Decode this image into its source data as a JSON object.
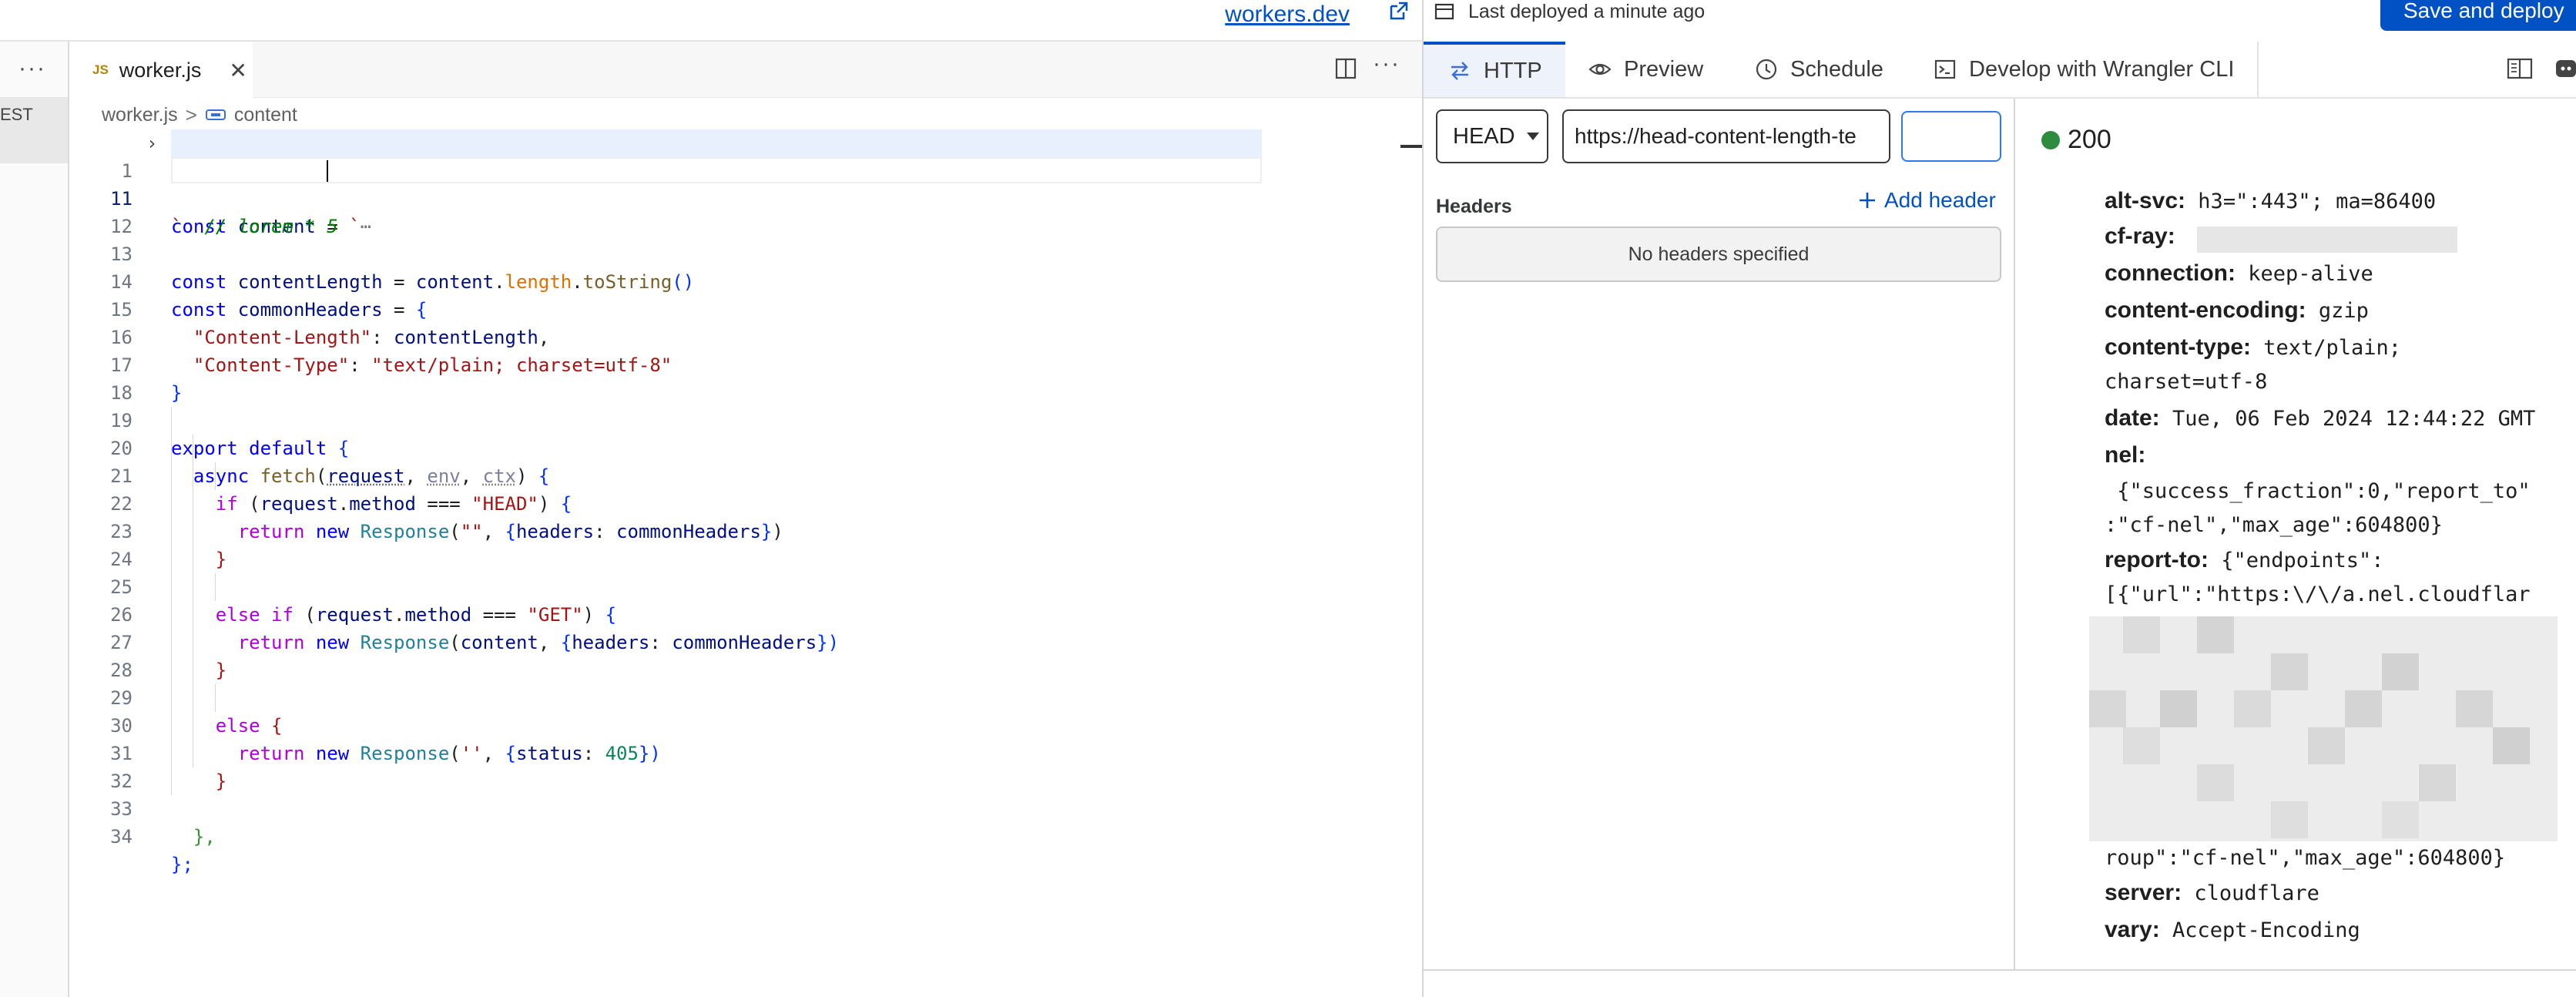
{
  "topbar": {
    "link_text": "workers.dev",
    "deploy_status": "Last deployed a minute ago",
    "save_deploy_label": "Save and deploy"
  },
  "left_strip": {
    "more": "···",
    "selected_label": "EST"
  },
  "editor": {
    "tab": {
      "badge": "JS",
      "filename": "worker.js",
      "close": "✕"
    },
    "more": "···",
    "breadcrumb": {
      "file": "worker.js",
      "separator": ">",
      "symbol": "content"
    },
    "active_line": 11,
    "lines": [
      {
        "n": "1"
      },
      {
        "n": "11"
      },
      {
        "n": "12"
      },
      {
        "n": "13"
      },
      {
        "n": "14"
      },
      {
        "n": "15"
      },
      {
        "n": "16"
      },
      {
        "n": "17"
      },
      {
        "n": "18"
      },
      {
        "n": "19"
      },
      {
        "n": "20"
      },
      {
        "n": "21"
      },
      {
        "n": "22"
      },
      {
        "n": "23"
      },
      {
        "n": "24"
      },
      {
        "n": "25"
      },
      {
        "n": "26"
      },
      {
        "n": "27"
      },
      {
        "n": "28"
      },
      {
        "n": "29"
      },
      {
        "n": "30"
      },
      {
        "n": "31"
      },
      {
        "n": "32"
      },
      {
        "n": "33"
      },
      {
        "n": "34"
      }
    ],
    "tokens": {
      "l1": [
        "const",
        "content",
        "=",
        "`",
        "⋯"
      ],
      "l11": [
        "`",
        "// lorem * 5"
      ],
      "l13": [
        "const",
        "contentLength",
        "=",
        "content",
        ".",
        "length",
        ".",
        "toString",
        "()"
      ],
      "l14": [
        "const",
        "commonHeaders",
        "=",
        "{"
      ],
      "l15": [
        "\"Content-Length\"",
        ": ",
        "contentLength",
        ","
      ],
      "l16": [
        "\"Content-Type\"",
        ": ",
        "\"text/plain; charset=utf-8\""
      ],
      "l17": [
        "}"
      ],
      "l19": [
        "export",
        "default",
        "{"
      ],
      "l20": [
        "async",
        "fetch",
        "(",
        "request",
        ", ",
        "env",
        ", ",
        "ctx",
        ") ",
        "{"
      ],
      "l21": [
        "if",
        " (",
        "request",
        ".",
        "method",
        " === ",
        "\"HEAD\"",
        ") ",
        "{"
      ],
      "l22": [
        "return",
        "new",
        "Response",
        "(",
        "\"\"",
        ", ",
        "{",
        "headers",
        ": ",
        "commonHeaders",
        "}",
        ")"
      ],
      "l23": [
        "}"
      ],
      "l25": [
        "else",
        "if",
        " (",
        "request",
        ".",
        "method",
        " === ",
        "\"GET\"",
        ") ",
        "{"
      ],
      "l26": [
        "return",
        "new",
        "Response",
        "(",
        "content",
        ", ",
        "{",
        "headers",
        ": ",
        "commonHeaders",
        "}",
        ")"
      ],
      "l27": [
        "}"
      ],
      "l29": [
        "else",
        "{"
      ],
      "l30": [
        "return",
        "new",
        "Response",
        "(",
        "''",
        ", ",
        "{",
        "status",
        ": ",
        "405",
        "}",
        ")"
      ],
      "l31": [
        "}"
      ],
      "l33": [
        "},"
      ],
      "l34": [
        "};"
      ]
    }
  },
  "right_panel": {
    "tabs": [
      {
        "label": "HTTP",
        "icon": "arrows-exchange-icon",
        "selected": true
      },
      {
        "label": "Preview",
        "icon": "eye-icon",
        "selected": false
      },
      {
        "label": "Schedule",
        "icon": "clock-icon",
        "selected": false
      },
      {
        "label": "Develop with Wrangler CLI",
        "icon": "terminal-icon",
        "selected": false
      }
    ],
    "request": {
      "method": "HEAD",
      "url": "https://head-content-length-te",
      "send_label": "",
      "headers_label": "Headers",
      "add_header_label": "Add header",
      "empty_headers": "No headers specified"
    },
    "response": {
      "status": "200",
      "status_color": "#2e8c3e",
      "headers": [
        {
          "key": "alt-svc:",
          "value": " h3=\":443\"; ma=86400"
        },
        {
          "key": "cf-ray:",
          "value": ""
        },
        {
          "key": "connection:",
          "value": " keep-alive"
        },
        {
          "key": "content-encoding:",
          "value": " gzip"
        },
        {
          "key": "content-type:",
          "value": " text/plain;"
        },
        {
          "key": "",
          "value": "charset=utf-8"
        },
        {
          "key": "date:",
          "value": " Tue, 06 Feb 2024 12:44:22 GMT"
        },
        {
          "key": "nel:",
          "value": ""
        },
        {
          "key": "",
          "value": " {\"success_fraction\":0,\"report_to\""
        },
        {
          "key": "",
          "value": ":\"cf-nel\",\"max_age\":604800}"
        },
        {
          "key": "report-to:",
          "value": " {\"endpoints\":"
        },
        {
          "key": "",
          "value": "[{\"url\":\"https:\\/\\/a.nel.cloudflar"
        },
        {
          "key": "",
          "value": "roup\":\"cf-nel\",\"max_age\":604800}"
        },
        {
          "key": "server:",
          "value": " cloudflare"
        },
        {
          "key": "vary:",
          "value": " Accept-Encoding"
        }
      ]
    }
  },
  "colors": {
    "accent": "#0051c3",
    "keyword": "#0000ff",
    "string": "#a31515",
    "number": "#098658"
  }
}
